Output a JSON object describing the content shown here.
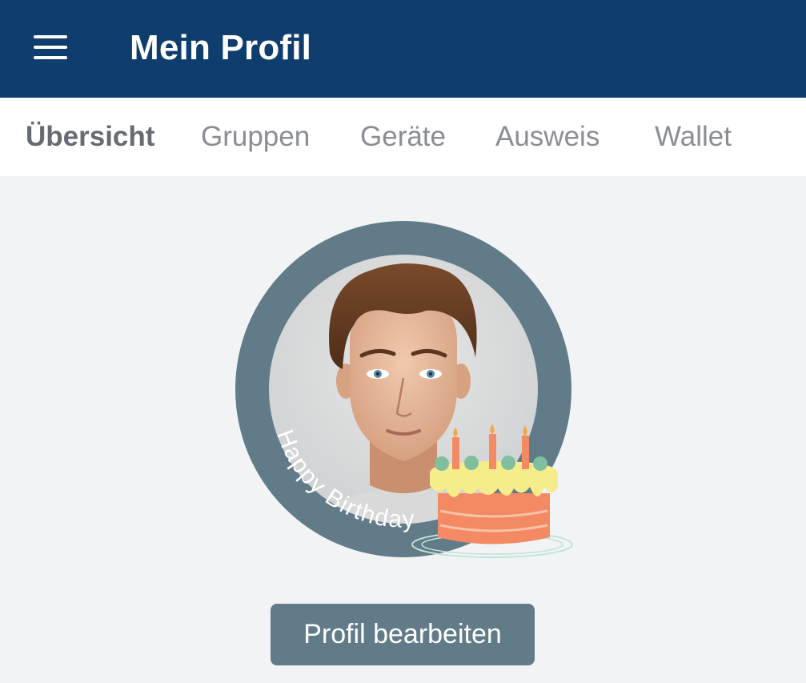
{
  "header": {
    "title": "Mein Profil",
    "menu_icon": "hamburger-menu-icon",
    "background": "#0f3e6e"
  },
  "tabs": [
    {
      "label": "Übersicht",
      "active": true
    },
    {
      "label": "Gruppen",
      "active": false
    },
    {
      "label": "Geräte",
      "active": false
    },
    {
      "label": "Ausweis",
      "active": false
    },
    {
      "label": "Wallet",
      "active": false
    }
  ],
  "profile": {
    "ring_text": "Happy Birthday",
    "ring_color": "#627b88",
    "decoration_icon": "birthday-cake-icon",
    "edit_label": "Profil bearbeiten"
  }
}
